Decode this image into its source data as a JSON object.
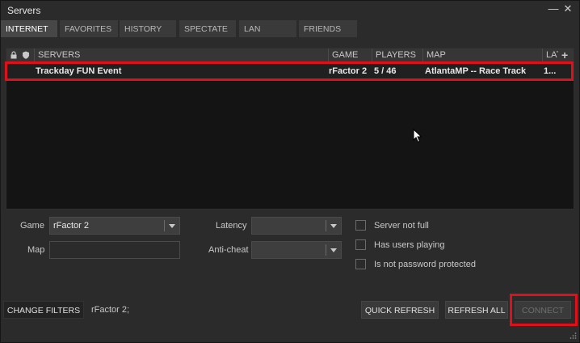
{
  "window": {
    "title": "Servers",
    "minimize_glyph": "—",
    "close_glyph": "✕"
  },
  "tabs": [
    {
      "label": "INTERNET",
      "active": true
    },
    {
      "label": "FAVORITES",
      "active": false
    },
    {
      "label": "HISTORY",
      "active": false
    },
    {
      "label": "SPECTATE",
      "active": false
    },
    {
      "label": "LAN",
      "active": false
    },
    {
      "label": "FRIENDS",
      "active": false
    }
  ],
  "table": {
    "columns": {
      "lock": "lock-icon",
      "antiCheat": "shield-icon",
      "servers": "SERVERS",
      "game": "GAME",
      "players": "PLAYERS",
      "map": "MAP",
      "latency": "LAT",
      "add": "+"
    },
    "rows": [
      {
        "server": "Trackday FUN Event",
        "game": "rFactor 2",
        "players": "5 / 46",
        "map": "AtlantaMP -- Race Track",
        "latency": "1..."
      }
    ]
  },
  "filters": {
    "game_label": "Game",
    "game_value": "rFactor 2",
    "map_label": "Map",
    "map_value": "",
    "latency_label": "Latency",
    "latency_value": "",
    "anticheat_label": "Anti-cheat",
    "anticheat_value": "",
    "checkboxes": [
      {
        "label": "Server not full",
        "checked": false
      },
      {
        "label": "Has users playing",
        "checked": false
      },
      {
        "label": "Is not password protected",
        "checked": false
      }
    ]
  },
  "footer": {
    "change_filters": "CHANGE FILTERS",
    "filter_summary": "rFactor 2;",
    "quick_refresh": "QUICK REFRESH",
    "refresh_all": "REFRESH ALL",
    "connect": "CONNECT"
  },
  "colors": {
    "highlight": "#e0101a",
    "background": "#2b2b2b"
  }
}
